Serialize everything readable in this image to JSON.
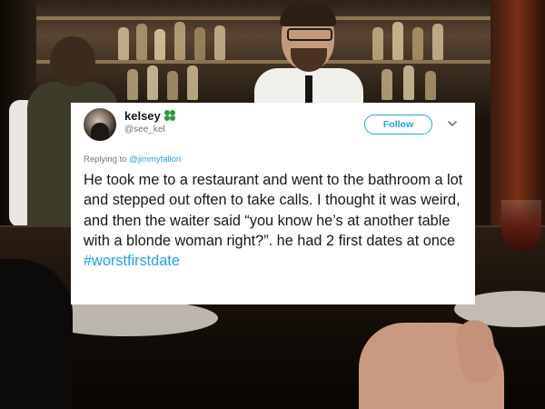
{
  "tweet": {
    "user": {
      "display_name": "kelsey",
      "badge_icon": "four-leaf-clover-icon",
      "handle": "@see_kel"
    },
    "follow_label": "Follow",
    "reply_prefix": "Replying to",
    "reply_to": "@jimmyfallon",
    "body": "He took me to a restaurant and went to the bathroom a lot and stepped out often to take calls. I thought it was weird, and then the waiter said “you know he’s at another table with a blonde woman right?”. he had 2 first dates at once",
    "hashtag": "#worstfirstdate"
  },
  "colors": {
    "accent": "#1da1f2",
    "text": "#14171a",
    "muted": "#657786",
    "clover": "#2c9c3a"
  }
}
